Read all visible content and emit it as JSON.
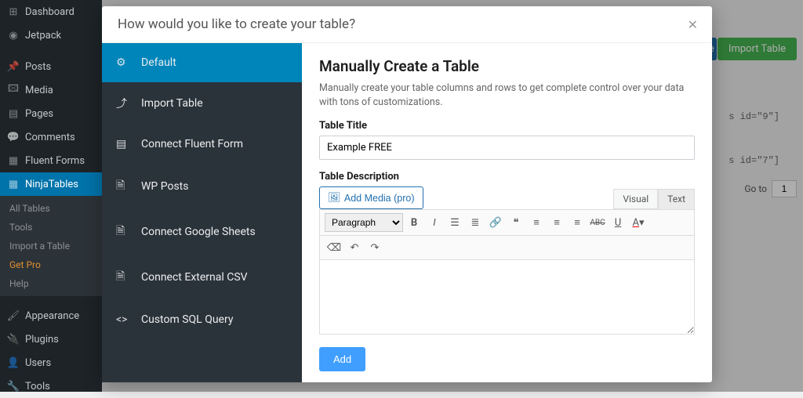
{
  "wp_sidebar": {
    "items": [
      {
        "label": "Dashboard",
        "icon": "dashboard"
      },
      {
        "label": "Jetpack",
        "icon": "jetpack"
      },
      {
        "label": "Posts",
        "icon": "pin"
      },
      {
        "label": "Media",
        "icon": "media"
      },
      {
        "label": "Pages",
        "icon": "page"
      },
      {
        "label": "Comments",
        "icon": "comment"
      },
      {
        "label": "Fluent Forms",
        "icon": "form"
      },
      {
        "label": "NinjaTables",
        "icon": "table",
        "active": true
      }
    ],
    "submenu": [
      {
        "label": "All Tables"
      },
      {
        "label": "Tools"
      },
      {
        "label": "Import a Table"
      },
      {
        "label": "Get Pro",
        "highlight": true
      },
      {
        "label": "Help"
      }
    ],
    "items_after": [
      {
        "label": "Appearance",
        "icon": "brush"
      },
      {
        "label": "Plugins",
        "icon": "plug"
      },
      {
        "label": "Users",
        "icon": "user"
      },
      {
        "label": "Tools",
        "icon": "wrench"
      }
    ]
  },
  "bg": {
    "import_btn": "Import Table",
    "snip1": "s id=\"9\"]",
    "snip2": "s id=\"7\"]",
    "goto": "Go to",
    "page": "1"
  },
  "modal": {
    "title": "How would you like to create your table?",
    "options": [
      {
        "label": "Default",
        "icon": "gear",
        "selected": true
      },
      {
        "label": "Import Table",
        "icon": "upload"
      },
      {
        "label": "Connect Fluent Form",
        "icon": "form"
      },
      {
        "label": "WP Posts",
        "icon": "doc"
      },
      {
        "label": "Connect Google Sheets",
        "icon": "sheet"
      },
      {
        "label": "Connect External CSV",
        "icon": "file"
      },
      {
        "label": "Custom SQL Query",
        "icon": "code"
      }
    ],
    "main": {
      "heading": "Manually Create a Table",
      "description": "Manually create your table columns and rows to get complete control over your data with tons of customizations.",
      "title_label": "Table Title",
      "title_value": "Example FREE",
      "desc_label": "Table Description",
      "add_media": "Add Media (pro)",
      "tab_visual": "Visual",
      "tab_text": "Text",
      "paragraph": "Paragraph",
      "add_btn": "Add"
    }
  }
}
